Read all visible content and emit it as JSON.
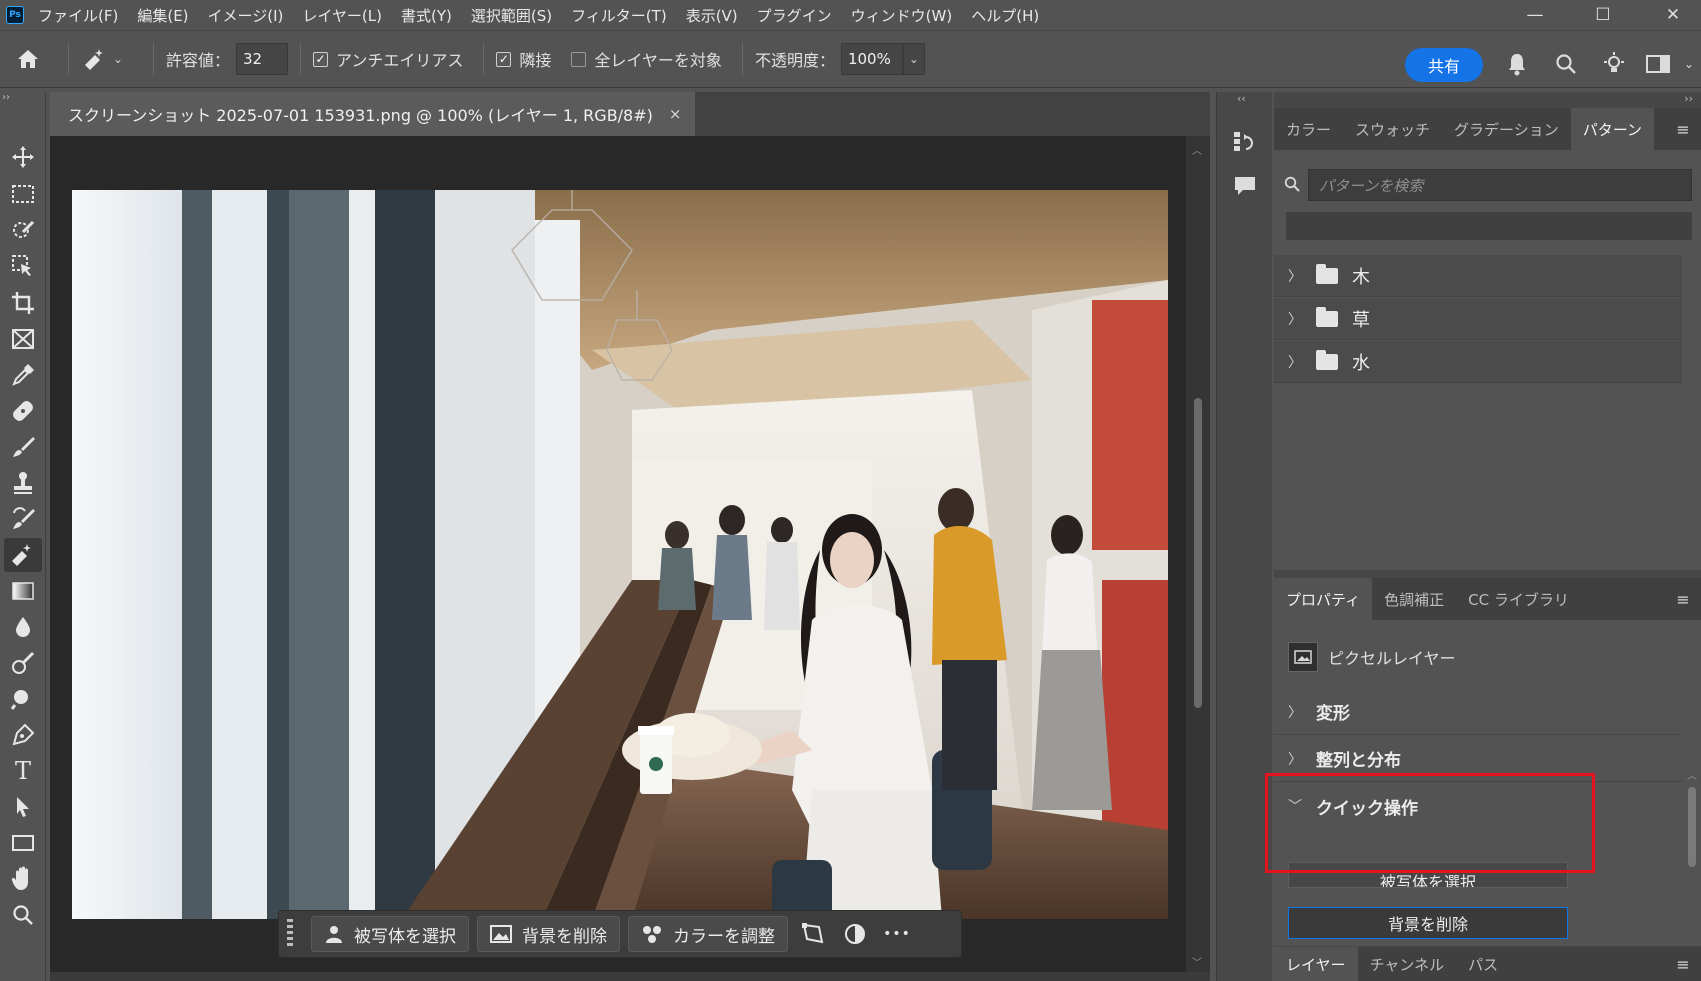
{
  "app": {
    "logo": "Ps"
  },
  "menu": [
    "ファイル(F)",
    "編集(E)",
    "イメージ(I)",
    "レイヤー(L)",
    "書式(Y)",
    "選択範囲(S)",
    "フィルター(T)",
    "表示(V)",
    "プラグイン",
    "ウィンドウ(W)",
    "ヘルプ(H)"
  ],
  "window_controls": {
    "minimize": "—",
    "maximize": "☐",
    "close": "✕"
  },
  "options": {
    "tolerance_label": "許容値：",
    "tolerance_value": "32",
    "antialias_label": "アンチエイリアス",
    "antialias_checked": true,
    "contiguous_label": "隣接",
    "contiguous_checked": true,
    "all_layers_label": "全レイヤーを対象",
    "all_layers_checked": false,
    "opacity_label": "不透明度：",
    "opacity_value": "100%",
    "share_label": "共有"
  },
  "tools": [
    "move-icon",
    "marquee-icon",
    "quick-select-icon",
    "object-select-icon",
    "crop-icon",
    "frame-icon",
    "eyedropper-icon",
    "healing-icon",
    "brush-icon",
    "stamp-icon",
    "history-brush-icon",
    "magic-eraser-icon",
    "gradient-icon",
    "blur-icon",
    "dodge-icon",
    "burn-icon",
    "pen-icon",
    "type-icon",
    "path-select-icon",
    "rectangle-icon",
    "hand-icon",
    "zoom-icon"
  ],
  "document": {
    "tab_title": "スクリーンショット 2025-07-01 153931.png @ 100% (レイヤー 1, RGB/8#)",
    "close": "×"
  },
  "context_bar": {
    "select_subject": "被写体を選択",
    "remove_bg": "背景を削除",
    "adjust_color": "カラーを調整",
    "more": "•••"
  },
  "patterns_panel": {
    "tabs": [
      "カラー",
      "スウォッチ",
      "グラデーション",
      "パターン"
    ],
    "active_tab": 3,
    "search_placeholder": "パターンを検索",
    "groups": [
      "木",
      "草",
      "水"
    ]
  },
  "properties_panel": {
    "tabs": [
      "プロパティ",
      "色調補正",
      "CC ライブラリ"
    ],
    "active_tab": 0,
    "layer_type": "ピクセルレイヤー",
    "sections": [
      "変形",
      "整列と分布",
      "クイック操作"
    ],
    "quick_actions": [
      "背景を削除",
      "被写体を選択"
    ]
  },
  "layers_panel": {
    "tabs": [
      "レイヤー",
      "チャンネル",
      "パス"
    ],
    "active_tab": 0
  },
  "colors": {
    "accent": "#1473e6",
    "highlight": "#e4141e"
  }
}
